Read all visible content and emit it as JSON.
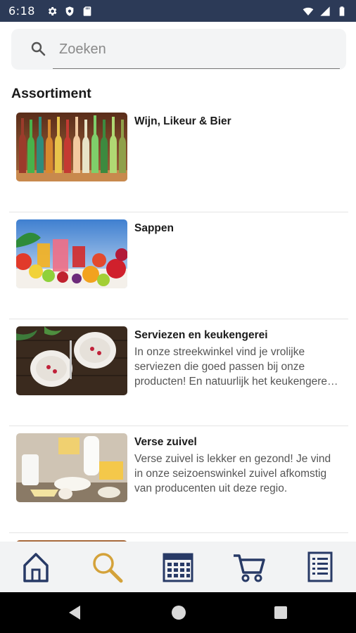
{
  "status_bar": {
    "time": "6:18",
    "left_icons": [
      "gear-icon",
      "shield-icon",
      "sd-card-icon"
    ],
    "right_icons": [
      "wifi-icon",
      "signal-icon",
      "battery-icon"
    ],
    "background": "#2c3a57"
  },
  "search": {
    "placeholder": "Zoeken",
    "value": ""
  },
  "section": {
    "title": "Assortiment"
  },
  "products": [
    {
      "title": "Wijn, Likeur & Bier",
      "description": "",
      "image": "wine-bottles-image"
    },
    {
      "title": "Sappen",
      "description": "",
      "image": "fruit-juices-image"
    },
    {
      "title": "Serviezen en keukengerei",
      "description": "In onze streekwinkel vind je vrolijke serviezen die goed passen bij onze producten! En natuurlijk het keukengerei waar je mee aan de slag kunt.",
      "image": "plates-image"
    },
    {
      "title": "Verse zuivel",
      "description": "Verse zuivel is lekker en gezond! Je vind in onze seizoenswinkel zuivel afkomstig van producenten uit deze regio.",
      "image": "dairy-image"
    }
  ],
  "bottom_nav": {
    "items": [
      {
        "name": "home",
        "icon": "home-icon",
        "active": false
      },
      {
        "name": "search",
        "icon": "search-icon",
        "active": true
      },
      {
        "name": "calendar",
        "icon": "calendar-icon",
        "active": false
      },
      {
        "name": "cart",
        "icon": "cart-icon",
        "active": false
      },
      {
        "name": "list",
        "icon": "list-icon",
        "active": false
      }
    ],
    "color": "#283a66",
    "active_color": "#d4a23a"
  }
}
